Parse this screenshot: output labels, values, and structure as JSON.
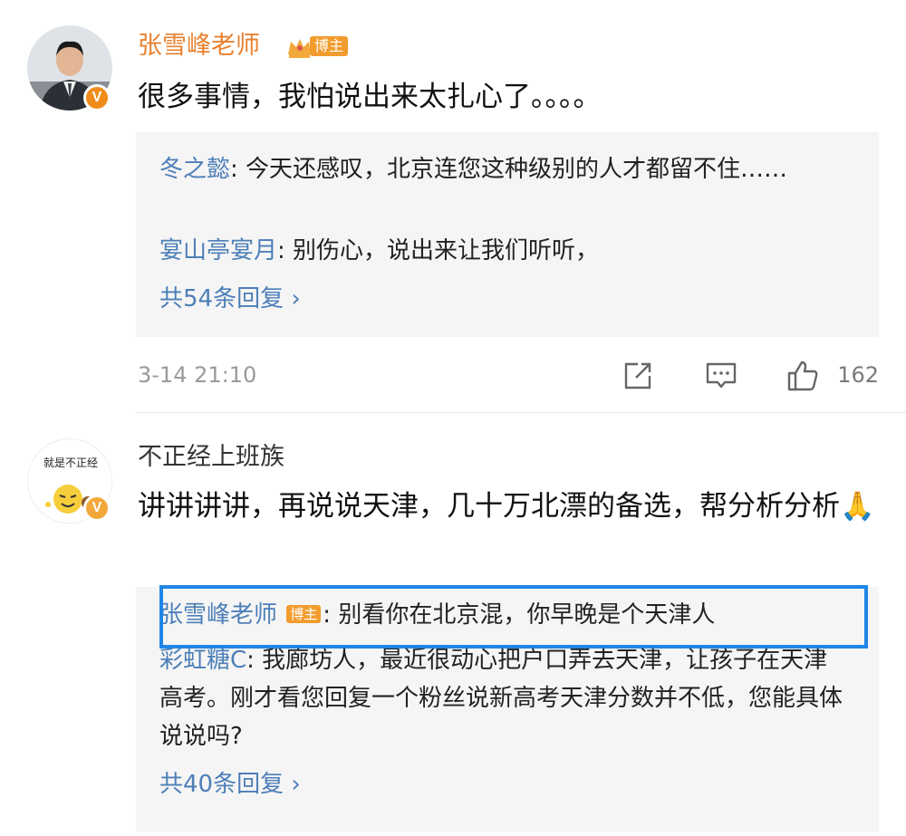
{
  "comments": [
    {
      "username": "张雪峰老师",
      "badge": "博主",
      "verified_mark": "V",
      "content": "很多事情，我怕说出来太扎心了。。。。",
      "replies": [
        {
          "name": "冬之懿",
          "text": ": 今天还感叹，北京连您这种级别的人才都留不住……"
        },
        {
          "name": "宴山亭宴月",
          "text": ": 别伤心，说出来让我们听听，"
        }
      ],
      "more_replies": "共54条回复 ›",
      "time": "3-14 21:10",
      "likes": "162",
      "icons": {
        "share": "share-icon",
        "comment": "comment-icon",
        "like": "like-icon"
      }
    },
    {
      "username": "不正经上班族",
      "avatar_text": "就是不正经",
      "verified_mark": "V",
      "content": "讲讲讲讲，再说说天津，几十万北漂的备选，帮分析分析🙏",
      "replies": [
        {
          "name": "张雪峰老师",
          "badge": "博主",
          "text": ": 别看你在北京混，你早晚是个天津人"
        },
        {
          "name": "彩虹糖C",
          "text": ": 我廊坊人，最近很动心把户口弄去天津，让孩子在天津高考。刚才看您回复一个粉丝说新高考天津分数并不低，您能具体说说吗?"
        }
      ],
      "more_replies": "共40条回复 ›"
    }
  ],
  "colors": {
    "accent_orange": "#e8802e",
    "link_blue": "#4d7fb8",
    "highlight_blue": "#1f86e6",
    "reply_bg": "#f5f5f5"
  }
}
